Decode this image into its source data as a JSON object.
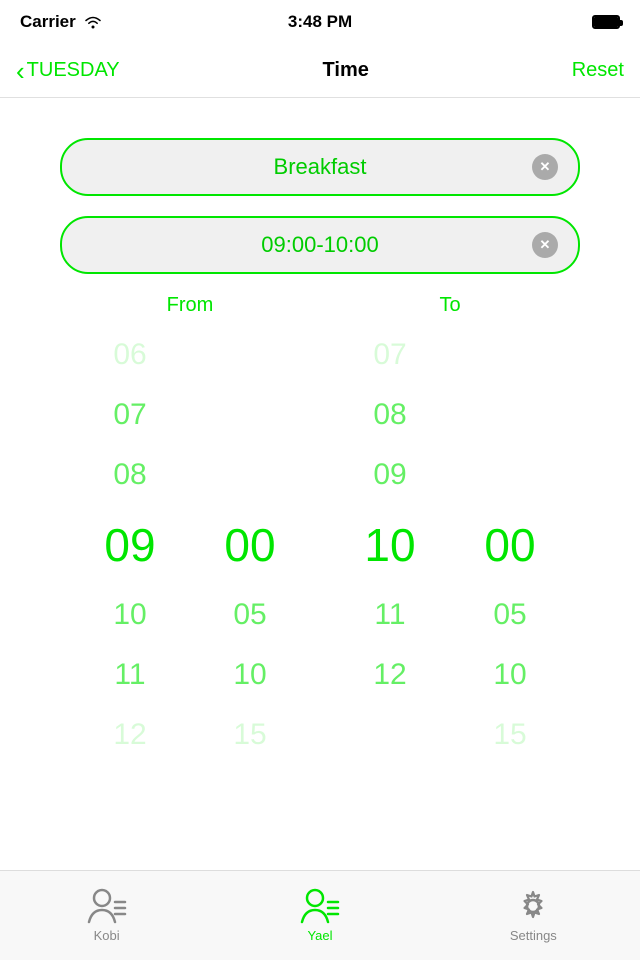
{
  "statusBar": {
    "carrier": "Carrier",
    "time": "3:48 PM"
  },
  "navBar": {
    "backLabel": "TUESDAY",
    "title": "Time",
    "resetLabel": "Reset"
  },
  "fields": {
    "meal": "Breakfast",
    "timeRange": "09:00-10:00"
  },
  "pickerFrom": {
    "label": "From",
    "hours": [
      "06",
      "07",
      "08",
      "09",
      "10",
      "11",
      "12"
    ],
    "minutes": [
      "",
      "",
      "",
      "00",
      "05",
      "10",
      "15"
    ],
    "selectedHour": "09",
    "selectedMinute": "00"
  },
  "pickerTo": {
    "label": "To",
    "hours": [
      "07",
      "08",
      "09",
      "10",
      "11",
      "12",
      ""
    ],
    "minutes": [
      "",
      "",
      "",
      "00",
      "05",
      "10",
      "15"
    ],
    "selectedHour": "10",
    "selectedMinute": "00"
  },
  "tabs": [
    {
      "id": "kobi",
      "label": "Kobi",
      "active": false
    },
    {
      "id": "yael",
      "label": "Yael",
      "active": true
    },
    {
      "id": "settings",
      "label": "Settings",
      "active": false
    }
  ]
}
